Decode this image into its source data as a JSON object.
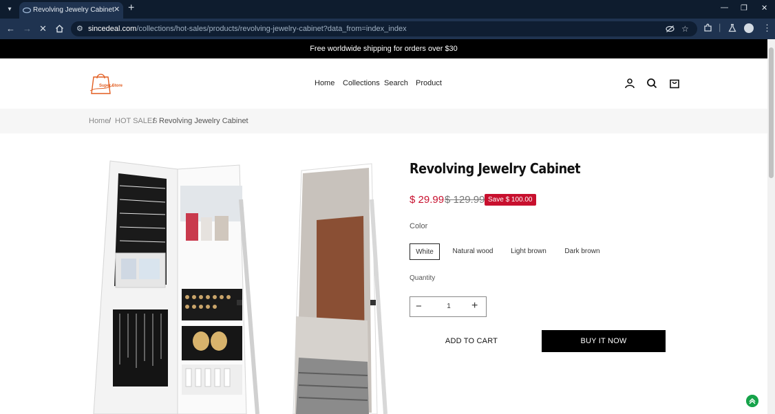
{
  "browser": {
    "tab_title": "Revolving Jewelry Cabinet - Ys",
    "url_host": "sincedeal.com",
    "url_path": "/collections/hot-sales/products/revolving-jewelry-cabinet?data_from=index_index"
  },
  "announcement": "Free worldwide shipping for orders over $30",
  "header": {
    "logo_text": "Super Store",
    "nav": [
      "Home",
      "Collections",
      "Search",
      "Product"
    ],
    "icons": [
      "account-icon",
      "search-icon",
      "cart-icon"
    ]
  },
  "breadcrumb": {
    "items": [
      "Home",
      "HOT SALES",
      "Revolving Jewelry Cabinet"
    ],
    "separator": "/"
  },
  "product": {
    "title": "Revolving Jewelry Cabinet",
    "price": "$ 29.99",
    "compare_price": "$ 129.99",
    "save_label": "Save $ 100.00",
    "color_label": "Color",
    "colors": [
      "White",
      "Natural wood",
      "Light brown",
      "Dark brown"
    ],
    "selected_color": "White",
    "quantity_label": "Quantity",
    "quantity": "1",
    "add_to_cart": "ADD TO CART",
    "buy_now": "BUY IT NOW"
  },
  "theme": {
    "accent": "#c8102e",
    "announce_bg": "#000000",
    "chrome_bg": "#1f3350",
    "chat_green": "#16a34a"
  }
}
